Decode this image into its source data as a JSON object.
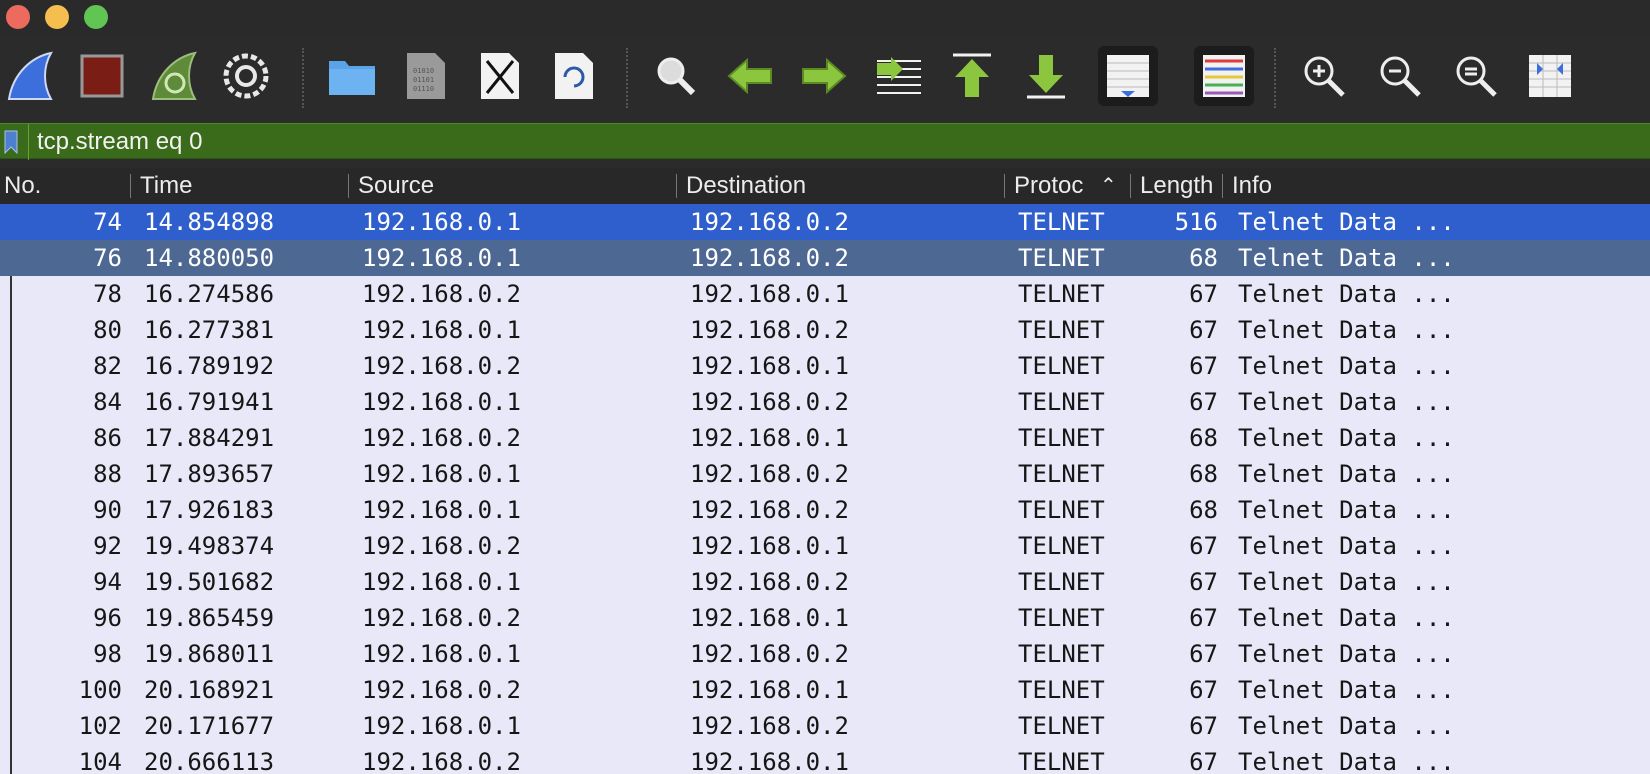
{
  "window": {
    "traffic_lights": {
      "close": "#ed6a5e",
      "minimize": "#f5bf4f",
      "zoom": "#61c554"
    }
  },
  "toolbar": {
    "buttons": [
      {
        "name": "start-capture-icon"
      },
      {
        "name": "stop-capture-icon"
      },
      {
        "name": "restart-capture-icon"
      },
      {
        "name": "capture-options-icon"
      },
      {
        "name": "open-file-icon"
      },
      {
        "name": "save-file-icon"
      },
      {
        "name": "close-file-icon"
      },
      {
        "name": "reload-file-icon"
      },
      {
        "name": "find-packet-icon"
      },
      {
        "name": "go-back-icon"
      },
      {
        "name": "go-forward-icon"
      },
      {
        "name": "go-to-packet-icon"
      },
      {
        "name": "go-first-packet-icon"
      },
      {
        "name": "go-last-packet-icon"
      },
      {
        "name": "auto-scroll-icon"
      },
      {
        "name": "colorize-icon"
      },
      {
        "name": "zoom-in-icon"
      },
      {
        "name": "zoom-out-icon"
      },
      {
        "name": "normal-size-icon"
      },
      {
        "name": "resize-columns-icon"
      }
    ]
  },
  "filter": {
    "value": "tcp.stream eq 0"
  },
  "columns": {
    "no": "No.",
    "time": "Time",
    "source": "Source",
    "destination": "Destination",
    "protocol": "Protoc",
    "sort_indicator": "⌃",
    "length": "Length",
    "info": "Info"
  },
  "packets": [
    {
      "no": "74",
      "time": "14.854898",
      "source": "192.168.0.1",
      "destination": "192.168.0.2",
      "protocol": "TELNET",
      "length": "516",
      "info": "Telnet Data ..."
    },
    {
      "no": "76",
      "time": "14.880050",
      "source": "192.168.0.1",
      "destination": "192.168.0.2",
      "protocol": "TELNET",
      "length": "68",
      "info": "Telnet Data ..."
    },
    {
      "no": "78",
      "time": "16.274586",
      "source": "192.168.0.2",
      "destination": "192.168.0.1",
      "protocol": "TELNET",
      "length": "67",
      "info": "Telnet Data ..."
    },
    {
      "no": "80",
      "time": "16.277381",
      "source": "192.168.0.1",
      "destination": "192.168.0.2",
      "protocol": "TELNET",
      "length": "67",
      "info": "Telnet Data ..."
    },
    {
      "no": "82",
      "time": "16.789192",
      "source": "192.168.0.2",
      "destination": "192.168.0.1",
      "protocol": "TELNET",
      "length": "67",
      "info": "Telnet Data ..."
    },
    {
      "no": "84",
      "time": "16.791941",
      "source": "192.168.0.1",
      "destination": "192.168.0.2",
      "protocol": "TELNET",
      "length": "67",
      "info": "Telnet Data ..."
    },
    {
      "no": "86",
      "time": "17.884291",
      "source": "192.168.0.2",
      "destination": "192.168.0.1",
      "protocol": "TELNET",
      "length": "68",
      "info": "Telnet Data ..."
    },
    {
      "no": "88",
      "time": "17.893657",
      "source": "192.168.0.1",
      "destination": "192.168.0.2",
      "protocol": "TELNET",
      "length": "68",
      "info": "Telnet Data ..."
    },
    {
      "no": "90",
      "time": "17.926183",
      "source": "192.168.0.1",
      "destination": "192.168.0.2",
      "protocol": "TELNET",
      "length": "68",
      "info": "Telnet Data ..."
    },
    {
      "no": "92",
      "time": "19.498374",
      "source": "192.168.0.2",
      "destination": "192.168.0.1",
      "protocol": "TELNET",
      "length": "67",
      "info": "Telnet Data ..."
    },
    {
      "no": "94",
      "time": "19.501682",
      "source": "192.168.0.1",
      "destination": "192.168.0.2",
      "protocol": "TELNET",
      "length": "67",
      "info": "Telnet Data ..."
    },
    {
      "no": "96",
      "time": "19.865459",
      "source": "192.168.0.2",
      "destination": "192.168.0.1",
      "protocol": "TELNET",
      "length": "67",
      "info": "Telnet Data ..."
    },
    {
      "no": "98",
      "time": "19.868011",
      "source": "192.168.0.1",
      "destination": "192.168.0.2",
      "protocol": "TELNET",
      "length": "67",
      "info": "Telnet Data ..."
    },
    {
      "no": "100",
      "time": "20.168921",
      "source": "192.168.0.2",
      "destination": "192.168.0.1",
      "protocol": "TELNET",
      "length": "67",
      "info": "Telnet Data ..."
    },
    {
      "no": "102",
      "time": "20.171677",
      "source": "192.168.0.1",
      "destination": "192.168.0.2",
      "protocol": "TELNET",
      "length": "67",
      "info": "Telnet Data ..."
    },
    {
      "no": "104",
      "time": "20.666113",
      "source": "192.168.0.2",
      "destination": "192.168.0.1",
      "protocol": "TELNET",
      "length": "67",
      "info": "Telnet Data ..."
    }
  ],
  "colors": {
    "selected_row": "#2e5fcc",
    "secondary_selected_row": "#4d6892",
    "row_background": "#e8e8f8",
    "filter_bar": "#3a6b1a"
  }
}
